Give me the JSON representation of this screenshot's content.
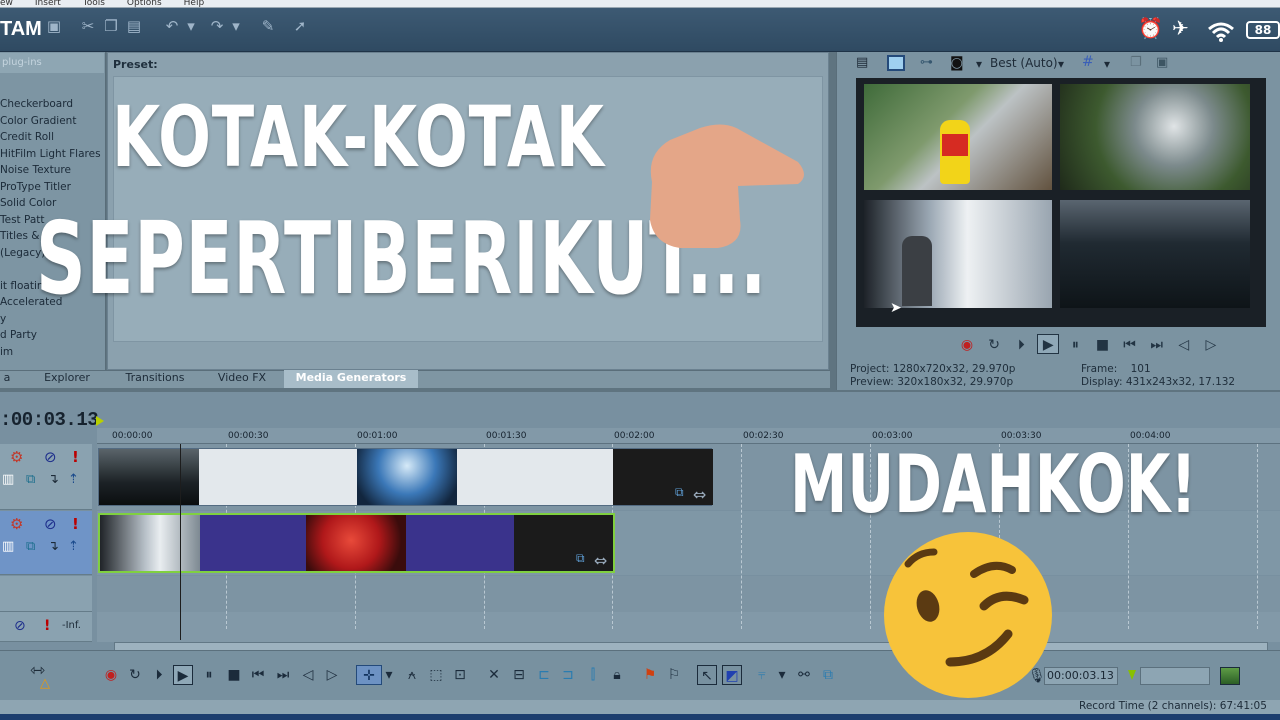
{
  "menu": {
    "items": [
      "ew",
      "Insert",
      "Tools",
      "Options",
      "Help"
    ]
  },
  "app": {
    "name": "TAM"
  },
  "status_icons": [
    "alarm-clock-icon",
    "airplane-icon",
    "wifi-icon"
  ],
  "battery": {
    "level": "88"
  },
  "left_panel": {
    "header": "plug-ins",
    "plugins": [
      "Checkerboard",
      "Color Gradient",
      "Credit Roll",
      "HitFilm Light Flares",
      "Noise Texture",
      "ProType Titler",
      "Solid Color",
      "Test Patt",
      "Titles & T",
      "(Legacy) T",
      "",
      "it floating",
      " Accelerated",
      "y",
      "d Party",
      "im"
    ]
  },
  "preset": {
    "label": "Preset:"
  },
  "tabs": [
    "a",
    "Explorer",
    "Transitions",
    "Video FX",
    "Media Generators"
  ],
  "preview": {
    "quality": "Best (Auto)",
    "project_label": "Project:",
    "project_value": "1280x720x32, 29.970p",
    "preview_label": "Preview:",
    "preview_value": "320x180x32, 29.970p",
    "frame_label": "Frame:",
    "frame_value": "101",
    "display_label": "Display:",
    "display_value": "431x243x32, 17.132"
  },
  "timeline": {
    "timecode": ":00:03.13",
    "ruler_ticks": [
      "00:00:00",
      "00:00:30",
      "00:01:00",
      "00:01:30",
      "00:02:00",
      "00:02:30",
      "00:03:00",
      "00:03:30",
      "00:04:00"
    ],
    "audio_level": "-Inf."
  },
  "bottom": {
    "timecode": "00:00:03.13"
  },
  "status": {
    "record_time": "Record Time (2 channels): 67:41:05"
  },
  "overlay": {
    "line1": "KOTAK-KOTAK",
    "line2": "SEPERTIBERIKUT...",
    "exclaim": "MUDAHKOK!",
    "pointing_emoji": "pointing-hand-icon",
    "wink_emoji": "winking-face-icon"
  },
  "colors": {
    "hand": "#e4a688",
    "wink_face": "#f7c33a",
    "track_selected": "#6f94c7"
  }
}
